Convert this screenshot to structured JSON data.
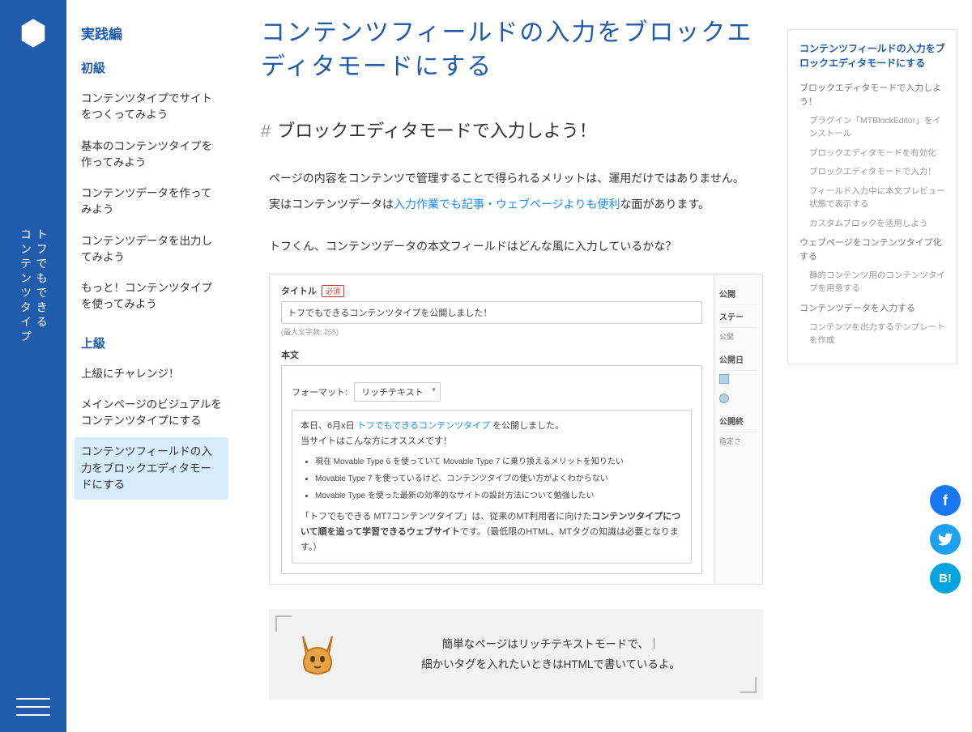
{
  "site_title_lines": [
    "トフでもできる",
    "コンテンツタイプ"
  ],
  "leftnav": {
    "heading": "実践編",
    "groups": [
      {
        "title": "初級",
        "items": [
          {
            "label": "コンテンツタイプでサイトをつくってみよう",
            "active": false
          },
          {
            "label": "基本のコンテンツタイプを作ってみよう",
            "active": false
          },
          {
            "label": "コンテンツデータを作ってみよう",
            "active": false
          },
          {
            "label": "コンテンツデータを出力してみよう",
            "active": false
          },
          {
            "label": "もっと！コンテンツタイプを使ってみよう",
            "active": false
          }
        ]
      },
      {
        "title": "上級",
        "items": [
          {
            "label": "上級にチャレンジ！",
            "active": false
          },
          {
            "label": "メインページのビジュアルをコンテンツタイプにする",
            "active": false
          },
          {
            "label": "コンテンツフィールドの入力をブロックエディタモードにする",
            "active": true
          }
        ]
      }
    ]
  },
  "page_title": "コンテンツフィールドの入力をブロックエディタモードにする",
  "h2": "ブロックエディタモードで入力しよう！",
  "body": {
    "p1": "ページの内容をコンテンツで管理することで得られるメリットは、運用だけではありません。",
    "p2a": "実はコンテンツデータは",
    "p2link": "入力作業でも記事・ウェブページよりも便利",
    "p2b": "な面があります。",
    "p3": "トフくん、コンテンツデータの本文フィールドはどんな風に入力しているかな？"
  },
  "editor": {
    "title_label": "タイトル",
    "required": "必須",
    "title_value": "トフでもできるコンテンツタイプを公開しました！",
    "maxchars": "(最大文字数: 255)",
    "body_label": "本文",
    "format_label": "フォーマット:",
    "format_value": "リッチテキスト",
    "content_line1a": "本日、6月x日",
    "content_line1link": "トフでもできるコンテンツタイプ",
    "content_line1b": "を公開しました。",
    "content_line2": "当サイトはこんな方にオススメです！",
    "bullets": [
      "現在 Movable Type 6 を使っていて Movable Type 7 に乗り換えるメリットを知りたい",
      "Movable Type 7 を使っているけど、コンテンツタイプの使い方がよくわからない",
      "Movable Type を使った最新の効率的なサイトの設計方法について勉強したい"
    ],
    "content_line3a": "「トフでもできる MT7コンテンツタイプ」は、従来のMT利用者に向けた",
    "content_line3bold": "コンテンツタイプについて順を追って学習できるウェブサイト",
    "content_line3b": "です。（最低限のHTML、MTタグの知識は必要となります。）",
    "side": {
      "publish": "公開",
      "status": "ステー",
      "status_val": "公開",
      "pubdate": "公開日",
      "pubend": "公開終",
      "pubend_val": "指定さ"
    }
  },
  "callout": {
    "line1": "簡単なページはリッチテキストモードで、｜",
    "line2": "細かいタグを入れたいときはHTMLで書いているよ。"
  },
  "toc": {
    "title": "コンテンツフィールドの入力をブロックエディタモードにする",
    "items": [
      {
        "label": "ブロックエディタモードで入力しよう！",
        "lvl": 1
      },
      {
        "label": "プラグイン「MTBlockEditor」をインストール",
        "lvl": 2
      },
      {
        "label": "ブロックエディタモードを有効化",
        "lvl": 2
      },
      {
        "label": "ブロックエディタモードで入力！",
        "lvl": 2
      },
      {
        "label": "フィールド入力中に本文プレビュー状態で表示する",
        "lvl": 2
      },
      {
        "label": "カスタムブロックを活用しよう",
        "lvl": 2
      },
      {
        "label": "ウェブページをコンテンツタイプ化する",
        "lvl": 1
      },
      {
        "label": "静的コンテンツ用のコンテンツタイプを用意する",
        "lvl": 2
      },
      {
        "label": "コンテンツデータを入力する",
        "lvl": 1
      },
      {
        "label": "コンテンツを出力するテンプレートを作成",
        "lvl": 2
      }
    ]
  },
  "social": {
    "fb": "f",
    "tw": "",
    "hb": "B!"
  }
}
